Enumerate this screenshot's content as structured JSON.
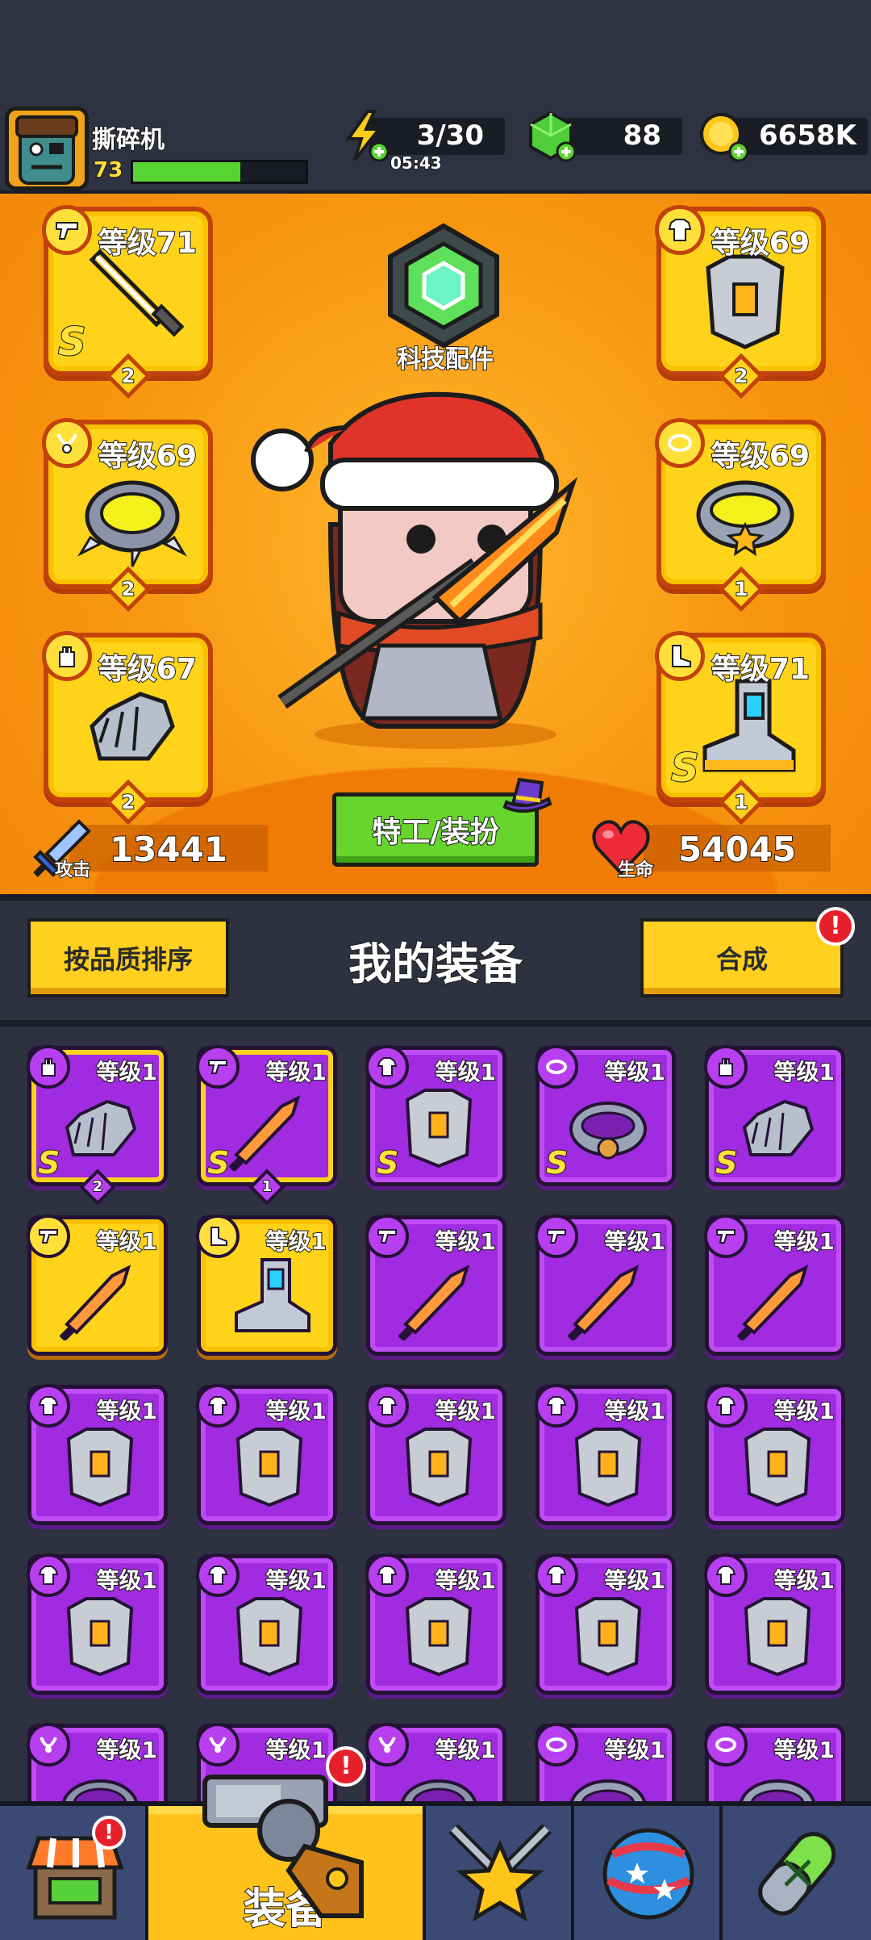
{
  "player": {
    "name": "撕碎机",
    "level": "73",
    "xp_fraction": 0.62
  },
  "resources": {
    "energy": "3/30",
    "energy_timer": "05:43",
    "gems": "88",
    "coins": "6658K"
  },
  "equipped": [
    {
      "slot": "weapon",
      "level": "等级71",
      "rank": "S",
      "stars": "2"
    },
    {
      "slot": "armor",
      "level": "等级69",
      "rank": "",
      "stars": "2"
    },
    {
      "slot": "necklace",
      "level": "等级69",
      "rank": "",
      "stars": "2"
    },
    {
      "slot": "belt",
      "level": "等级69",
      "rank": "",
      "stars": "1"
    },
    {
      "slot": "gloves",
      "level": "等级67",
      "rank": "",
      "stars": "2"
    },
    {
      "slot": "boots",
      "level": "等级71",
      "rank": "S",
      "stars": "1"
    }
  ],
  "tech": {
    "label": "科技配件"
  },
  "stats": {
    "attack_label": "攻击",
    "attack": "13441",
    "hp_label": "生命",
    "hp": "54045"
  },
  "costume_button": "特工/装扮",
  "panel": {
    "sort_button": "按品质排序",
    "title": "我的装备",
    "merge_button": "合成",
    "merge_badge": "!"
  },
  "inventory": [
    {
      "level": "等级1",
      "slot": "gloves",
      "rank": "S",
      "stars": "2",
      "color": "purple-sel"
    },
    {
      "level": "等级1",
      "slot": "weapon",
      "rank": "S",
      "stars": "1",
      "color": "purple-sel"
    },
    {
      "level": "等级1",
      "slot": "armor",
      "rank": "S",
      "stars": "",
      "color": "purple"
    },
    {
      "level": "等级1",
      "slot": "belt",
      "rank": "S",
      "stars": "",
      "color": "purple"
    },
    {
      "level": "等级1",
      "slot": "gloves",
      "rank": "S",
      "stars": "",
      "color": "purple"
    },
    {
      "level": "等级1",
      "slot": "weapon",
      "rank": "",
      "stars": "",
      "color": "yellow"
    },
    {
      "level": "等级1",
      "slot": "boots",
      "rank": "",
      "stars": "",
      "color": "yellow"
    },
    {
      "level": "等级1",
      "slot": "weapon",
      "rank": "",
      "stars": "",
      "color": "purple"
    },
    {
      "level": "等级1",
      "slot": "weapon",
      "rank": "",
      "stars": "",
      "color": "purple"
    },
    {
      "level": "等级1",
      "slot": "weapon",
      "rank": "",
      "stars": "",
      "color": "purple"
    },
    {
      "level": "等级1",
      "slot": "armor",
      "rank": "",
      "stars": "",
      "color": "purple"
    },
    {
      "level": "等级1",
      "slot": "armor",
      "rank": "",
      "stars": "",
      "color": "purple"
    },
    {
      "level": "等级1",
      "slot": "armor",
      "rank": "",
      "stars": "",
      "color": "purple"
    },
    {
      "level": "等级1",
      "slot": "armor",
      "rank": "",
      "stars": "",
      "color": "purple"
    },
    {
      "level": "等级1",
      "slot": "armor",
      "rank": "",
      "stars": "",
      "color": "purple"
    },
    {
      "level": "等级1",
      "slot": "armor",
      "rank": "",
      "stars": "",
      "color": "purple"
    },
    {
      "level": "等级1",
      "slot": "armor",
      "rank": "",
      "stars": "",
      "color": "purple"
    },
    {
      "level": "等级1",
      "slot": "armor",
      "rank": "",
      "stars": "",
      "color": "purple"
    },
    {
      "level": "等级1",
      "slot": "armor",
      "rank": "",
      "stars": "",
      "color": "purple"
    },
    {
      "level": "等级1",
      "slot": "armor",
      "rank": "",
      "stars": "",
      "color": "purple"
    },
    {
      "level": "等级1",
      "slot": "necklace",
      "rank": "",
      "stars": "",
      "color": "purple"
    },
    {
      "level": "等级1",
      "slot": "necklace",
      "rank": "",
      "stars": "",
      "color": "purple"
    },
    {
      "level": "等级1",
      "slot": "necklace",
      "rank": "",
      "stars": "",
      "color": "purple"
    },
    {
      "level": "等级1",
      "slot": "belt",
      "rank": "",
      "stars": "",
      "color": "purple"
    },
    {
      "level": "等级1",
      "slot": "belt",
      "rank": "",
      "stars": "",
      "color": "purple"
    }
  ],
  "nav": {
    "active_label": "装备",
    "shop_badge": "!",
    "equip_badge": "!"
  },
  "colors": {
    "accent_orange": "#f7960f",
    "item_purple": "#a02be0",
    "item_yellow": "#ffd319",
    "green_button": "#67d52c"
  }
}
